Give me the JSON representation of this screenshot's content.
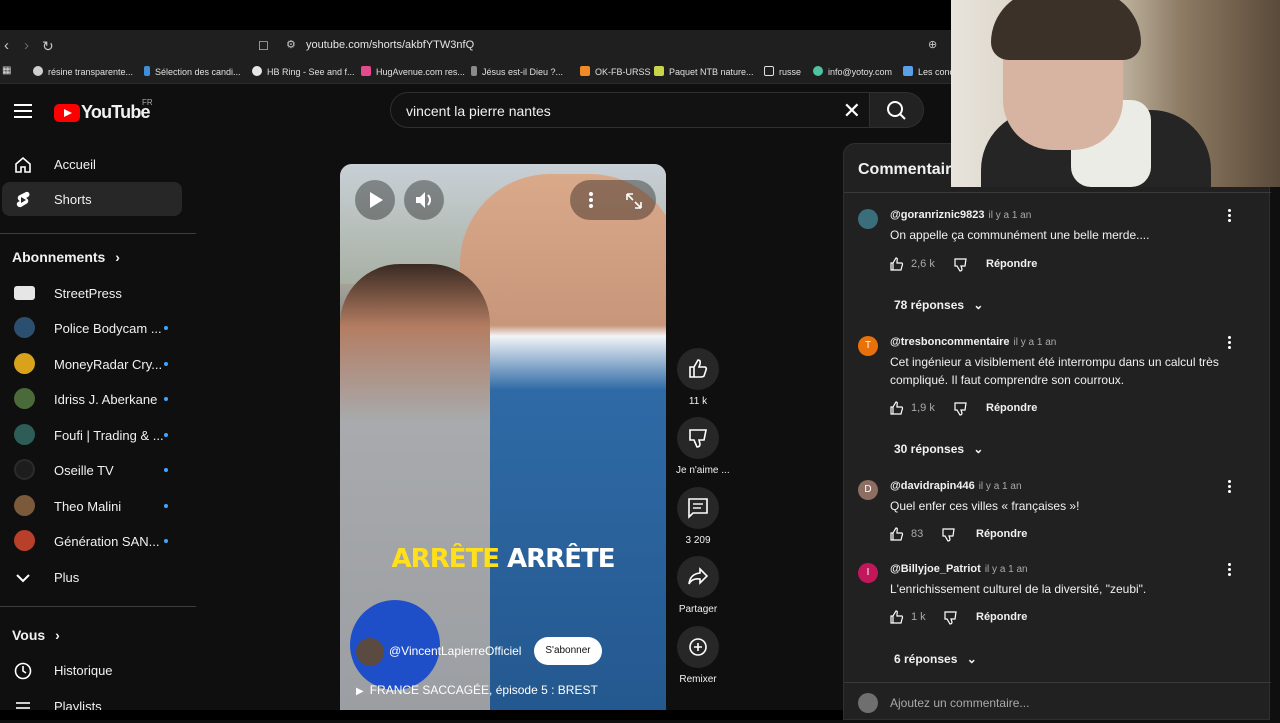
{
  "browser": {
    "url": "youtube.com/shorts/akbfYTW3nfQ",
    "bookmarks": [
      {
        "label": "résine transparente...",
        "color": "#cfcfcf"
      },
      {
        "label": "Sélection des candi...",
        "color": "#3c8fd8"
      },
      {
        "label": "HB Ring - See and f...",
        "color": "#e6e6e6"
      },
      {
        "label": "HugAvenue.com res...",
        "color": "#e44b8c"
      },
      {
        "label": "Jésus est-il Dieu ?...",
        "color": "#8a8a8a"
      },
      {
        "label": "OK-FB-URSS",
        "color": "#f08a24"
      },
      {
        "label": "Paquet NTB nature...",
        "color": "#c9d44a"
      },
      {
        "label": "russe",
        "color": "#e0e0e0"
      },
      {
        "label": "info@yotoy.com",
        "color": "#4fc3a1"
      },
      {
        "label": "Les conc",
        "color": "#5aa0e6"
      }
    ]
  },
  "header": {
    "logo_text": "YouTube",
    "country": "FR",
    "search_value": "vincent la pierre nantes"
  },
  "sidebar": {
    "main_items": [
      {
        "label": "Accueil",
        "icon": "home-icon"
      },
      {
        "label": "Shorts",
        "icon": "shorts-icon"
      }
    ],
    "subscriptions_heading": "Abonnements",
    "subscriptions": [
      {
        "label": "StreetPress",
        "color": "#e6e6e6",
        "dot": false
      },
      {
        "label": "Police Bodycam ...",
        "color": "#2b4f6e",
        "dot": true
      },
      {
        "label": "MoneyRadar Cry...",
        "color": "#d9a21b",
        "dot": true
      },
      {
        "label": "Idriss J. Aberkane",
        "color": "#4a6a3a",
        "dot": true
      },
      {
        "label": "Foufi | Trading & ...",
        "color": "#2e5d58",
        "dot": true
      },
      {
        "label": "Oseille TV",
        "color": "#1d1d1d",
        "dot": true
      },
      {
        "label": "Theo Malini",
        "color": "#7a5a3a",
        "dot": true
      },
      {
        "label": "Génération SAN...",
        "color": "#b8402a",
        "dot": true
      }
    ],
    "more_label": "Plus",
    "you_heading": "Vous",
    "you_items": [
      {
        "label": "Historique",
        "icon": "history-icon"
      },
      {
        "label": "Playlists",
        "icon": "playlists-icon"
      }
    ]
  },
  "video": {
    "subtitle_word1": "ARRÊTE",
    "subtitle_word2": "ARRÊTE",
    "channel": "@VincentLapierreOfficiel",
    "subscribe_label": "S'abonner",
    "title": "FRANCE SACCAGÉE, épisode 5 : BREST"
  },
  "actions": {
    "like_count": "11 k",
    "dislike_label": "Je n'aime ...",
    "comment_count": "3 209",
    "share_label": "Partager",
    "remix_label": "Remixer"
  },
  "comments": {
    "title": "Commentaires",
    "reply_label": "Répondre",
    "add_placeholder": "Ajoutez un commentaire...",
    "items": [
      {
        "author": "@goranriznic9823",
        "time": "il y a 1 an",
        "text": "On appelle ça communément une belle merde....",
        "likes": "2,6 k",
        "replies": "78 réponses",
        "avatar_letter": "",
        "avatar_color": "#3a6e7a"
      },
      {
        "author": "@tresboncommentaire",
        "time": "il y a 1 an",
        "text": "Cet ingénieur a visiblement été interrompu dans un calcul très compliqué. Il faut comprendre son courroux.",
        "likes": "1,9 k",
        "replies": "30 réponses",
        "avatar_letter": "T",
        "avatar_color": "#e8710a"
      },
      {
        "author": "@davidrapin446",
        "time": "il y a 1 an",
        "text": "Quel enfer ces villes « françaises »!",
        "likes": "83",
        "replies": "",
        "avatar_letter": "D",
        "avatar_color": "#8d6e63"
      },
      {
        "author": "@Billyjoe_Patriot",
        "time": "il y a 1 an",
        "text": "L'enrichissement culturel de la diversité, \"zeubi\".",
        "likes": "1 k",
        "replies": "6 réponses",
        "avatar_letter": "I",
        "avatar_color": "#c2185b"
      }
    ]
  }
}
